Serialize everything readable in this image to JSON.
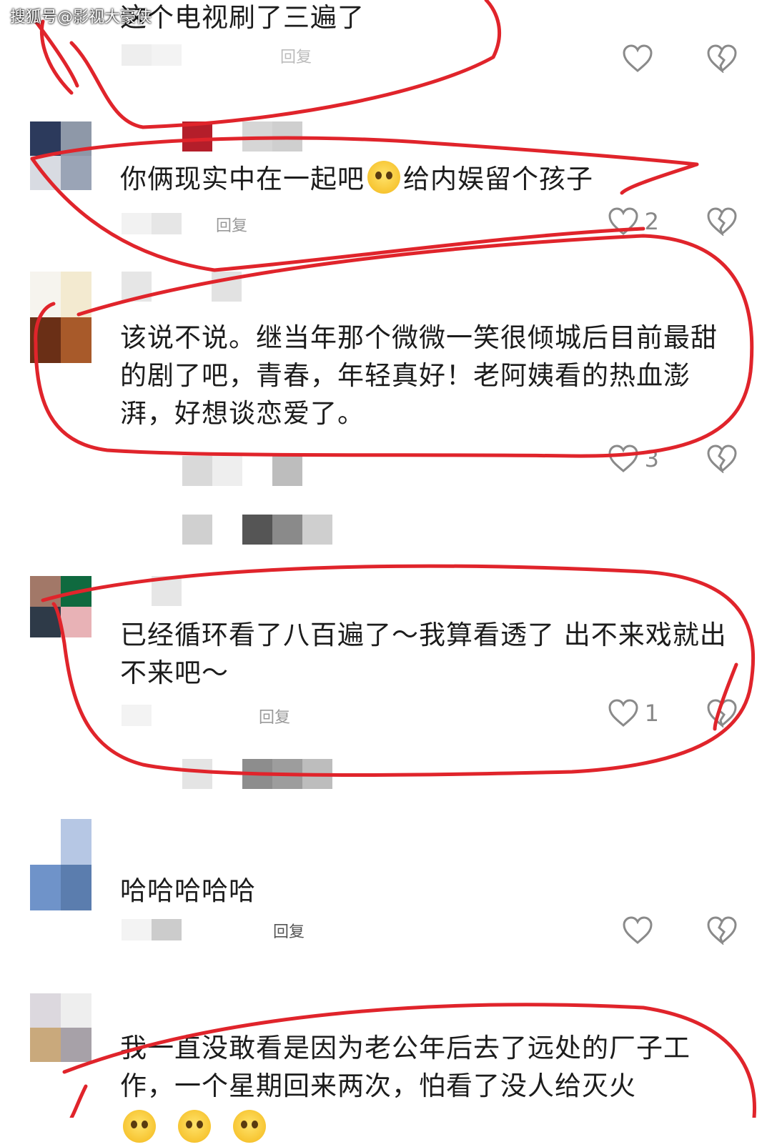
{
  "watermark": "搜狐号@影视大豪侠",
  "comments": [
    {
      "text": "这个电视刷了三遍了",
      "likes": "",
      "reply_label": "回复"
    },
    {
      "text_a": "你俩现实中在一起吧",
      "text_b": "给内娱留个孩子",
      "likes": "2",
      "reply_label": "回复"
    },
    {
      "text": "该说不说。继当年那个微微一笑很倾城后目前最甜的剧了吧，青春，年轻真好！老阿姨看的热血澎湃，好想谈恋爱了。",
      "likes": "3",
      "reply_label": "回复"
    },
    {
      "text": "已经循环看了八百遍了～我算看透了 出不来戏就出不来吧～",
      "likes": "1",
      "reply_label": "回复"
    },
    {
      "text": "哈哈哈哈哈",
      "likes": "",
      "reply_label": "回复"
    },
    {
      "text": "我一直没敢看是因为老公年后去了远处的厂子工作，一个星期回来两次，怕看了没人给灭火",
      "likes": "",
      "reply_label": ""
    }
  ],
  "icons": {
    "like": "heart-outline-icon",
    "dislike": "broken-heart-icon",
    "emoji": "pleading-face-emoji"
  },
  "colors": {
    "annotation": "#e0242b",
    "text": "#1c1c1c",
    "meta": "#9a9a9a"
  }
}
